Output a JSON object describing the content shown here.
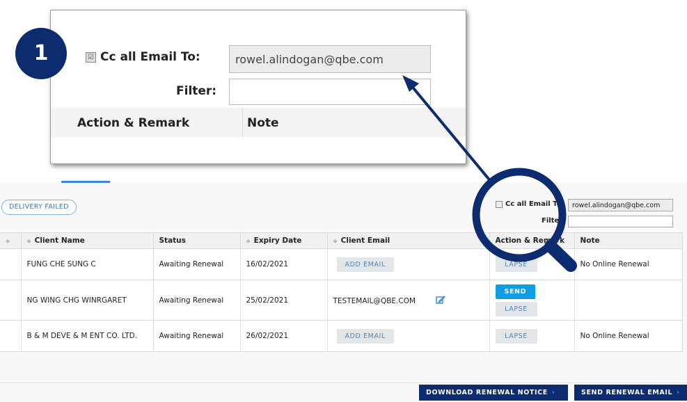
{
  "callout": {
    "badge_number": "1",
    "cc_label": "Cc all Email To:",
    "cc_email": "rowel.alindogan@qbe.com",
    "filter_label": "Filter:",
    "col_action": "Action & Remark",
    "col_note": "Note"
  },
  "toolbar": {
    "delivery_failed": "DELIVERY FAILED",
    "cc_label": "Cc all Email To:",
    "cc_email": "rowel.alindogan@qbe.com",
    "filter_label": "Filter:"
  },
  "table": {
    "headers": [
      "Client Name",
      "Status",
      "Expiry Date",
      "Client Email",
      "Action & Remark",
      "Note"
    ],
    "rows": [
      {
        "client": "FUNG CHE SUNG C",
        "status": "Awaiting Renewal",
        "expiry": "16/02/2021",
        "email_button": "ADD EMAIL",
        "lapse": "LAPSE",
        "note": "No Online Renewal"
      },
      {
        "client": "NG WING CHG WINRGARET",
        "status": "Awaiting Renewal",
        "expiry": "25/02/2021",
        "email": "TESTEMAIL@QBE.COM",
        "send": "SEND",
        "lapse": "LAPSE",
        "note": ""
      },
      {
        "client": "B & M DEVE & M ENT CO. LTD.",
        "status": "Awaiting Renewal",
        "expiry": "26/02/2021",
        "email_button": "ADD EMAIL",
        "lapse": "LAPSE",
        "note": "No Online Renewal"
      }
    ]
  },
  "footer": {
    "download_label": "DOWNLOAD RENEWAL NOTICE",
    "send_label": "SEND RENEWAL EMAIL"
  },
  "colors": {
    "navy": "#0d2b6f",
    "send_blue": "#0f9de8",
    "link_blue": "#4c86b8"
  },
  "icons": [
    "magnifier-icon",
    "pointer-arrow-icon",
    "edit-icon",
    "chevron-right-icon",
    "sort-icon"
  ]
}
